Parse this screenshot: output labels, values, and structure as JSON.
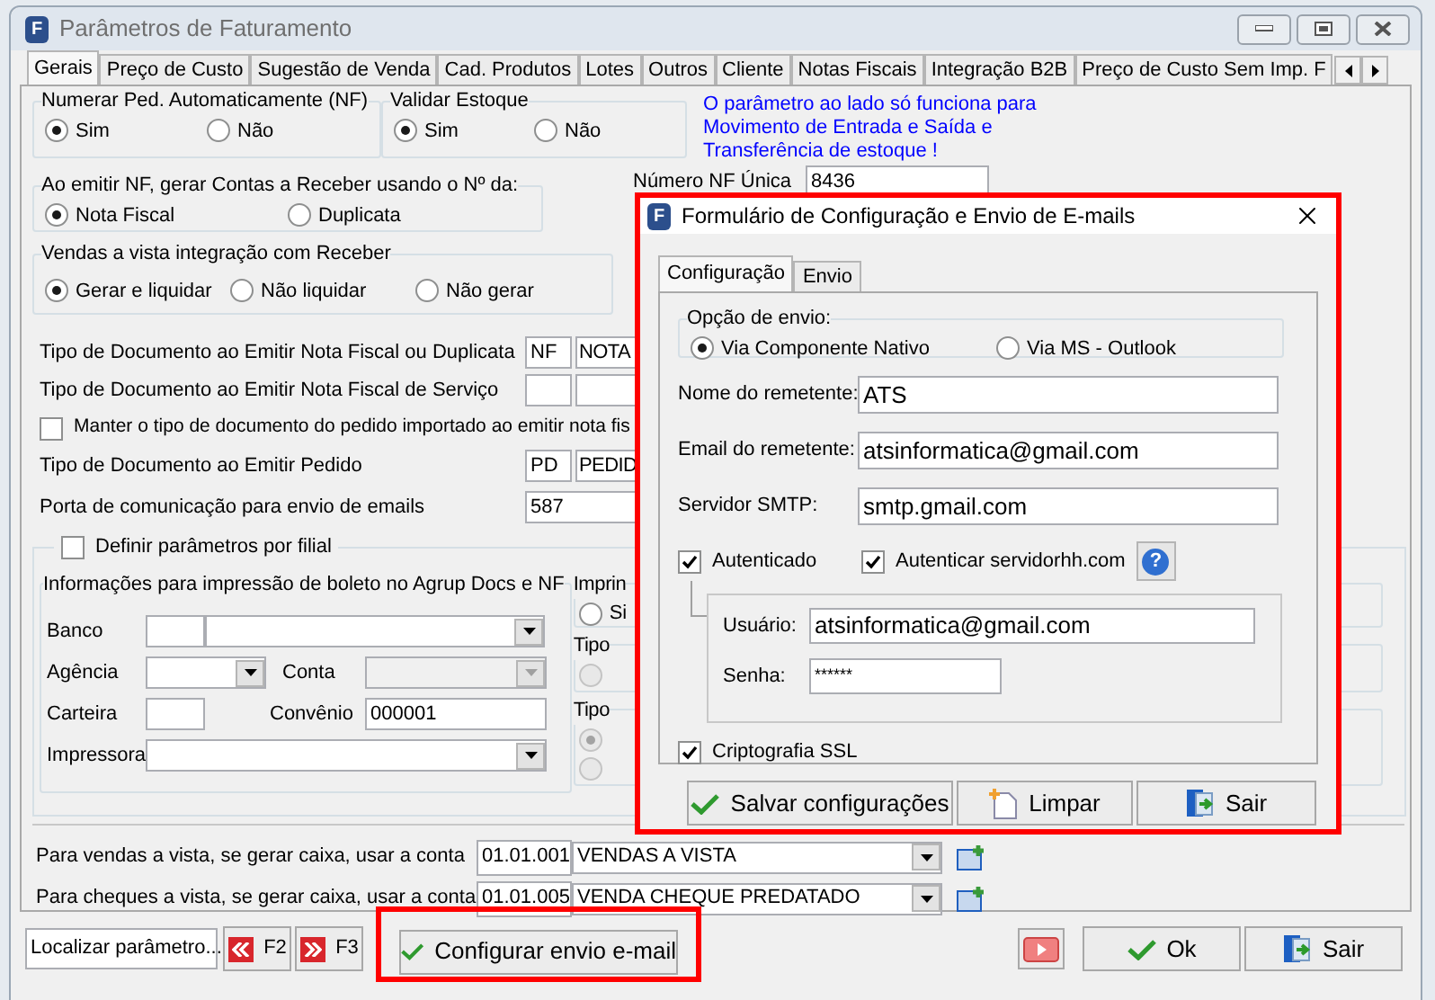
{
  "window": {
    "icon_letter": "F",
    "title": "Parâmetros de Faturamento"
  },
  "tabs": [
    {
      "label": "Gerais",
      "selected": true
    },
    {
      "label": "Preço de Custo",
      "selected": false
    },
    {
      "label": "Sugestão de  Venda",
      "selected": false
    },
    {
      "label": "Cad. Produtos",
      "selected": false
    },
    {
      "label": "Lotes",
      "selected": false
    },
    {
      "label": "Outros",
      "selected": false
    },
    {
      "label": "Cliente",
      "selected": false
    },
    {
      "label": "Notas Fiscais",
      "selected": false
    },
    {
      "label": "Integração B2B",
      "selected": false
    },
    {
      "label": "Preço de Custo Sem Imp. F",
      "selected": false
    }
  ],
  "general": {
    "numbering": {
      "legend": "Numerar Ped. Automaticamente (NF)",
      "options": [
        {
          "label": "Sim",
          "selected": true
        },
        {
          "label": "Não",
          "selected": false
        }
      ]
    },
    "stock": {
      "legend": "Validar Estoque",
      "options": [
        {
          "label": "Sim",
          "selected": true
        },
        {
          "label": "Não",
          "selected": false
        }
      ]
    },
    "notice": "O parâmetro ao lado só funciona para Movimento de Entrada e Saída e Transferência de estoque !",
    "receivables": {
      "legend": "Ao emitir NF, gerar Contas a Receber usando o Nº da:",
      "options": [
        {
          "label": "Nota Fiscal",
          "selected": true
        },
        {
          "label": "Duplicata",
          "selected": false
        }
      ]
    },
    "invoice_number": {
      "label": "Número NF Única",
      "value": "8436"
    },
    "cash_sales": {
      "legend": "Vendas a vista integração com Receber",
      "options": [
        {
          "label": "Gerar e liquidar",
          "selected": true
        },
        {
          "label": "Não liquidar",
          "selected": false
        },
        {
          "label": "Não gerar",
          "selected": false
        }
      ]
    },
    "doc_types": [
      {
        "label": "Tipo de Documento ao Emitir Nota Fiscal ou Duplicata",
        "code": "NF",
        "name": "NOTA"
      },
      {
        "label": "Tipo de Documento ao Emitir Nota Fiscal de Serviço"
      }
    ],
    "keep_type": {
      "label": "Manter o tipo de documento do pedido importado ao emitir nota fis",
      "checked": false
    },
    "order_type": {
      "label": "Tipo de Documento ao Emitir Pedido",
      "code": "PD",
      "name": "PEDID"
    },
    "email_port": {
      "label": "Porta de comunicação para envio de emails",
      "value": "587"
    },
    "per_branch": {
      "label": "Definir parâmetros por filial",
      "checked": false
    },
    "boleto": {
      "legend": "Informações para impressão de boleto no Agrup Docs e NF",
      "bank": "Banco",
      "agency": "Agência",
      "account": "Conta",
      "wallet": "Carteira",
      "agreement": {
        "label": "Convênio",
        "value": "000001"
      },
      "printer": "Impressora"
    },
    "side_groups": [
      {
        "legend": "Imprin",
        "options": [
          {
            "label": "Si",
            "selected": false,
            "disabled": false
          }
        ]
      },
      {
        "legend": "Tipo",
        "options": [
          {
            "selected": false,
            "disabled": true
          }
        ]
      },
      {
        "legend": "Tipo",
        "options": [
          {
            "selected": true,
            "disabled": true
          },
          {
            "selected": false,
            "disabled": true
          }
        ]
      }
    ],
    "accounts": [
      {
        "label": "Para vendas a vista, se gerar caixa, usar a conta",
        "code": "01.01.001",
        "name": "VENDAS A VISTA"
      },
      {
        "label": "Para cheques a vista, se gerar caixa, usar a conta",
        "code": "01.01.005",
        "name": "VENDA CHEQUE PREDATADO"
      }
    ]
  },
  "footer": {
    "search": {
      "value": "Localizar parâmetro..."
    },
    "prev": {
      "label": "F2"
    },
    "next": {
      "label": "F3"
    },
    "configure": {
      "label": "Configurar envio e-mail",
      "highlighted": true
    },
    "ok": {
      "label": "Ok"
    },
    "exit": {
      "label": "Sair"
    }
  },
  "dialog": {
    "icon_letter": "F",
    "title": "Formulário de Configuração e Envio de E-mails",
    "tabs": [
      {
        "label": "Configuração",
        "selected": true
      },
      {
        "label": "Envio",
        "selected": false
      }
    ],
    "send_option": {
      "legend": "Opção de envio:",
      "options": [
        {
          "label": "Via Componente Nativo",
          "selected": true
        },
        {
          "label": "Via MS - Outlook",
          "selected": false
        }
      ]
    },
    "fields": [
      {
        "label": "Nome do remetente:",
        "value": "ATS"
      },
      {
        "label": "Email do remetente:",
        "value": "atsinformatica@gmail.com"
      },
      {
        "label": "Servidor SMTP:",
        "value": "smtp.gmail.com"
      }
    ],
    "auth": [
      {
        "label": "Autenticado",
        "checked": true
      },
      {
        "label": "Autenticar servidorhh.com",
        "checked": true
      }
    ],
    "help": {
      "label": "?"
    },
    "credentials": [
      {
        "label": "Usuário:",
        "value": "atsinformatica@gmail.com",
        "kind": "text"
      },
      {
        "label": "Senha:",
        "value": "******",
        "kind": "password"
      }
    ],
    "ssl": {
      "label": "Criptografia SSL",
      "checked": true
    },
    "buttons": [
      {
        "label": "Salvar configurações",
        "kind": "save"
      },
      {
        "label": "Limpar",
        "kind": "clear"
      },
      {
        "label": "Sair",
        "kind": "exit"
      }
    ],
    "highlighted": true
  }
}
